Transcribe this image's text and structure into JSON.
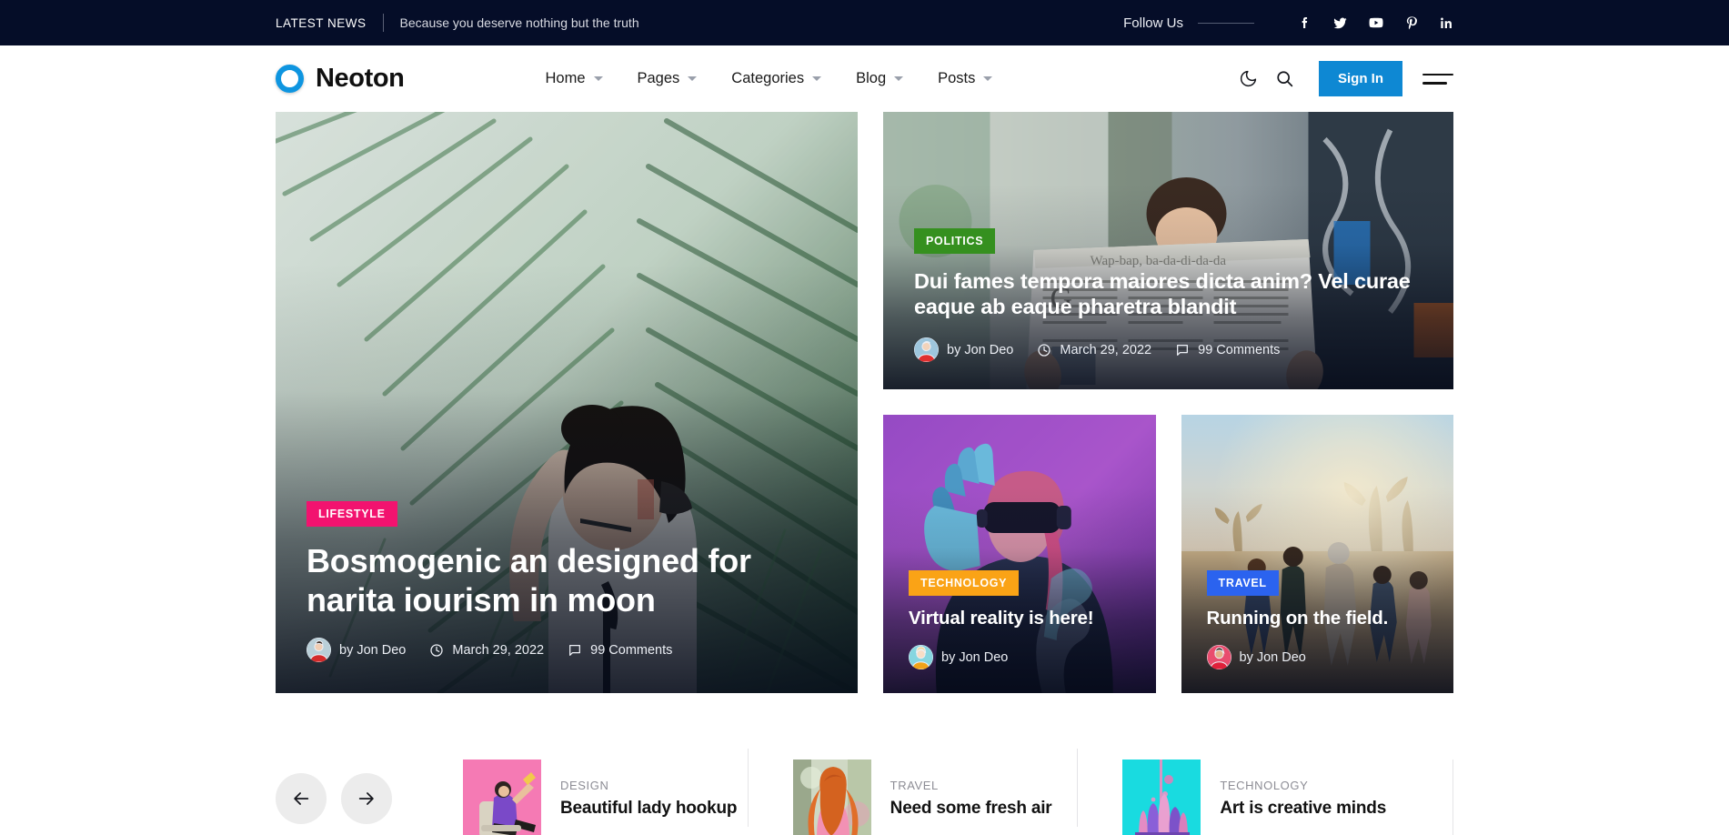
{
  "topbar": {
    "latest_label": "LATEST NEWS",
    "ticker": "Because you deserve nothing but the truth",
    "follow_label": "Follow Us",
    "socials": [
      {
        "name": "facebook-icon",
        "label": "Facebook"
      },
      {
        "name": "twitter-icon",
        "label": "Twitter"
      },
      {
        "name": "youtube-icon",
        "label": "YouTube"
      },
      {
        "name": "pinterest-icon",
        "label": "Pinterest"
      },
      {
        "name": "linkedin-icon",
        "label": "LinkedIn"
      }
    ],
    "bg_color": "#050d28"
  },
  "header": {
    "brand": "Neoton",
    "logo_color": "#0e95e0",
    "nav": [
      {
        "label": "Home",
        "has_dropdown": true
      },
      {
        "label": "Pages",
        "has_dropdown": true
      },
      {
        "label": "Categories",
        "has_dropdown": true
      },
      {
        "label": "Blog",
        "has_dropdown": true
      },
      {
        "label": "Posts",
        "has_dropdown": true
      }
    ],
    "dark_mode_icon": "moon-icon",
    "search_icon": "search-icon",
    "signin_label": "Sign In",
    "signin_color": "#0e88d3",
    "menu_icon": "hamburger-icon"
  },
  "hero": {
    "main": {
      "category": "LIFESTYLE",
      "category_color": "#f2136f",
      "title": "Bosmogenic an designed for narita iourism in moon",
      "author": "by Jon Deo",
      "date": "March 29, 2022",
      "comments": "99 Comments"
    },
    "top": {
      "category": "POLITICS",
      "category_color": "#35901f",
      "title": "Dui fames tempora maiores dicta anim? Vel curae eaque ab eaque pharetra blandit",
      "author": "by Jon Deo",
      "date": "March 29, 2022",
      "comments": "99 Comments"
    },
    "small": [
      {
        "category": "TECHNOLOGY",
        "category_color": "#faa316",
        "title": "Virtual reality is here!",
        "author": "by Jon Deo"
      },
      {
        "category": "TRAVEL",
        "category_color": "#2b63ef",
        "title": "Running on the field.",
        "author": "by Jon Deo"
      }
    ]
  },
  "trending": {
    "prev_icon": "arrow-left-icon",
    "next_icon": "arrow-right-icon",
    "items": [
      {
        "category": "DESIGN",
        "title": "Beautiful lady hookup"
      },
      {
        "category": "TRAVEL",
        "title": "Need some fresh air"
      },
      {
        "category": "TECHNOLOGY",
        "title": "Art is creative minds"
      }
    ]
  }
}
